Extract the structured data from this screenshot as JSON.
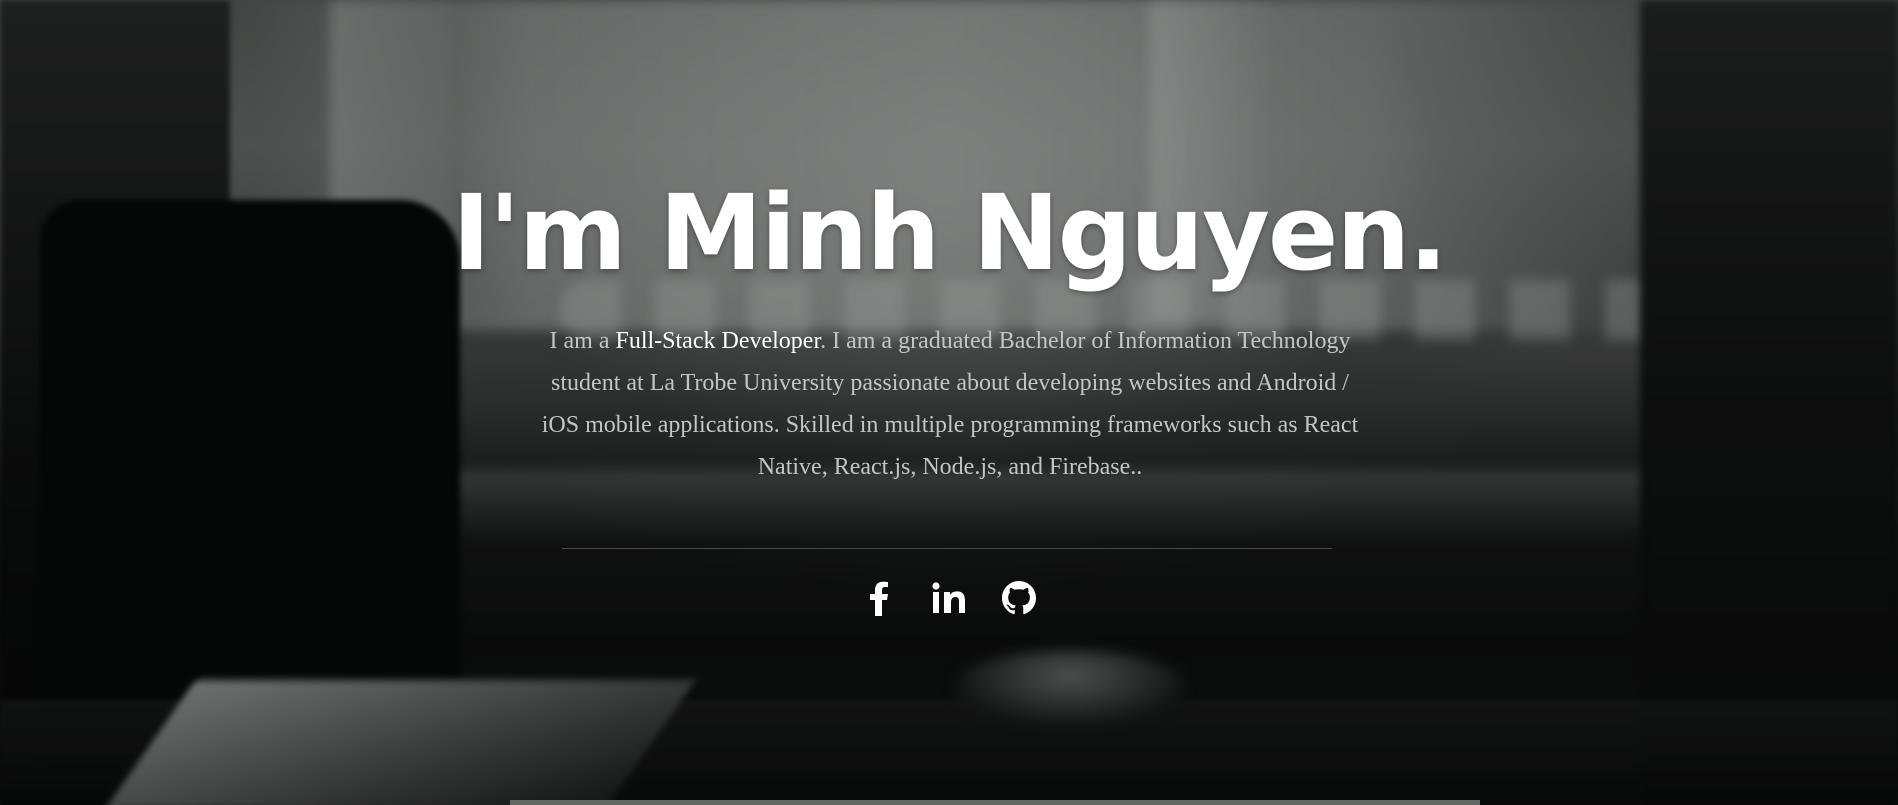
{
  "hero": {
    "headline": "I'm Minh Nguyen.",
    "bio": {
      "prefix": "I am a ",
      "highlight": "Full-Stack Developer",
      "rest": ". I am a graduated Bachelor of Information Technology student at La Trobe University passionate about developing websites and Android / iOS mobile applications. Skilled in multiple programming frameworks such as React Native, React.js, Node.js, and Firebase.."
    },
    "social": [
      {
        "icon": "facebook-icon"
      },
      {
        "icon": "linkedin-icon"
      },
      {
        "icon": "github-icon"
      }
    ]
  },
  "colors": {
    "headline": "#ffffff",
    "bio_text": "#c3c6c4",
    "highlight": "#ffffff",
    "divider": "#505251"
  }
}
